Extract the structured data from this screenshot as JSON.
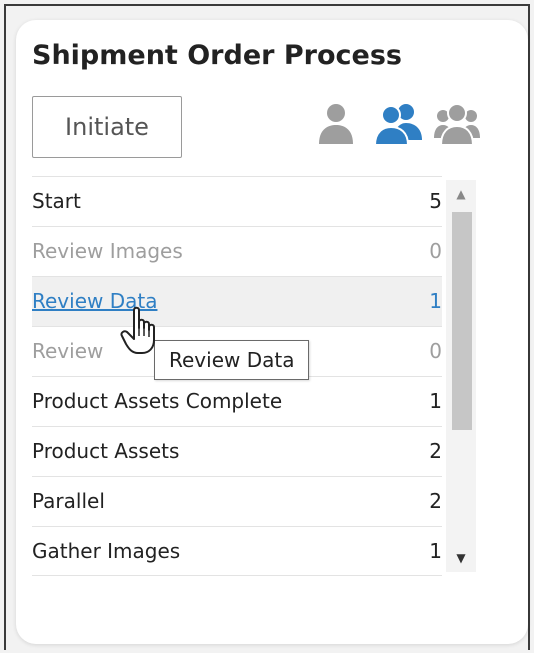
{
  "header": {
    "title": "Shipment Order Process"
  },
  "toolbar": {
    "initiate_label": "Initiate",
    "views": [
      {
        "icon": "single-user-icon",
        "active": false
      },
      {
        "icon": "two-users-icon",
        "active": true
      },
      {
        "icon": "group-users-icon",
        "active": false
      }
    ]
  },
  "colors": {
    "link": "#2f7fc4",
    "active_icon": "#2f7fc4",
    "inactive_icon": "#9e9e9e"
  },
  "steps": [
    {
      "label": "Start",
      "count": "5",
      "state": "normal"
    },
    {
      "label": "Review Images",
      "count": "0",
      "state": "dim"
    },
    {
      "label": "Review Data",
      "count": "1",
      "state": "link"
    },
    {
      "label": "Review",
      "count": "0",
      "state": "dim"
    },
    {
      "label": "Product Assets Complete",
      "count": "1",
      "state": "normal"
    },
    {
      "label": "Product Assets",
      "count": "2",
      "state": "normal"
    },
    {
      "label": "Parallel",
      "count": "2",
      "state": "normal"
    },
    {
      "label": "Gather Images",
      "count": "1",
      "state": "normal"
    }
  ],
  "tooltip": {
    "text": "Review Data"
  }
}
